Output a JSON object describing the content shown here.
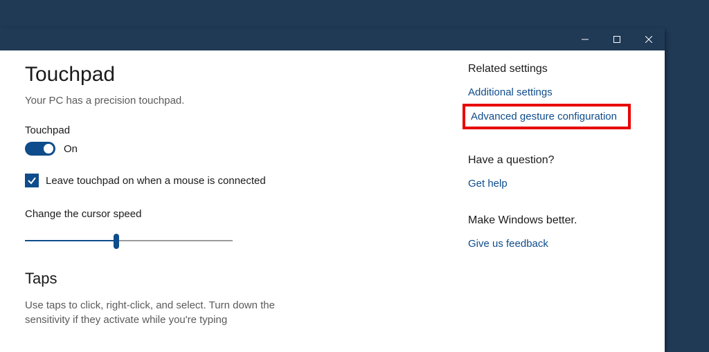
{
  "page": {
    "title": "Touchpad",
    "subtitle": "Your PC has a precision touchpad."
  },
  "toggle": {
    "section": "Touchpad",
    "state_label": "On"
  },
  "checkbox": {
    "label": "Leave touchpad on when a mouse is connected"
  },
  "slider": {
    "label": "Change the cursor speed"
  },
  "taps": {
    "heading": "Taps",
    "body": "Use taps to click, right-click, and select. Turn down the sensitivity if they activate while you're typing"
  },
  "related": {
    "heading": "Related settings",
    "link1": "Additional settings",
    "link2": "Advanced gesture configuration"
  },
  "question": {
    "heading": "Have a question?",
    "link": "Get help"
  },
  "feedback": {
    "heading": "Make Windows better.",
    "link": "Give us feedback"
  }
}
